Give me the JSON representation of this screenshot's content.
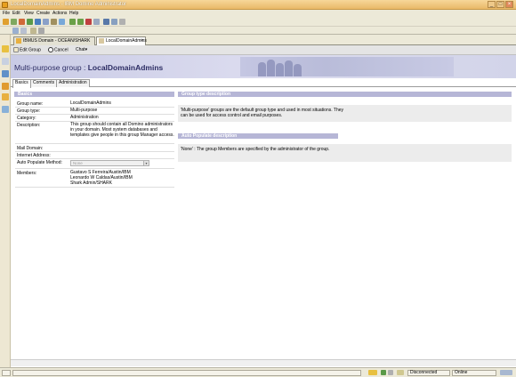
{
  "window": {
    "title": "LocalDomainAdmins - IBM Domino Administrator"
  },
  "menu": {
    "items": [
      "File",
      "Edit",
      "View",
      "Create",
      "Actions",
      "Help"
    ]
  },
  "doc_tabs": [
    {
      "label": "IBMUS Domain - OCEAN/SHARK"
    },
    {
      "label": "LocalDomainAdmins",
      "close": "×"
    }
  ],
  "actions": {
    "edit_group": "Edit Group",
    "cancel": "Cancel",
    "chat": "Chat"
  },
  "page": {
    "title_prefix": "Multi-purpose group :",
    "title_name": "LocalDomainAdmins"
  },
  "form_tabs": [
    "Basics",
    "Comments",
    "Administration"
  ],
  "basics": {
    "header": "Basics",
    "labels": {
      "group_name": "Group name:",
      "group_type": "Group type:",
      "category": "Category:",
      "description": "Description:",
      "mail_domain": "Mail Domain:",
      "internet_address": "Internet Address:",
      "auto_populate": "Auto Populate Method:",
      "members": "Members:"
    },
    "values": {
      "group_name": "LocalDomainAdmins",
      "group_type": "Multi-purpose",
      "category": "Administration",
      "description": "This group should contain all Domino administrators in your domain. Most system databases and templates give people in this group Manager access.",
      "auto_populate": "None",
      "members": [
        "Gustavo S Ferreira/Austin/IBM",
        "Leonardo W Caldas/Austin/IBM",
        "Shark Admin/SHARK"
      ]
    }
  },
  "group_type_description": {
    "header": "Group type description",
    "text": "'Multi-purpose' groups are the default group type and used in most situations. They can be used for access control and email purposes."
  },
  "auto_populate_description": {
    "header": "Auto Populate description",
    "text": "'None' : The group Members are specified by the administrator of the group."
  },
  "status": {
    "connection": "Disconnected",
    "location": "Online"
  }
}
